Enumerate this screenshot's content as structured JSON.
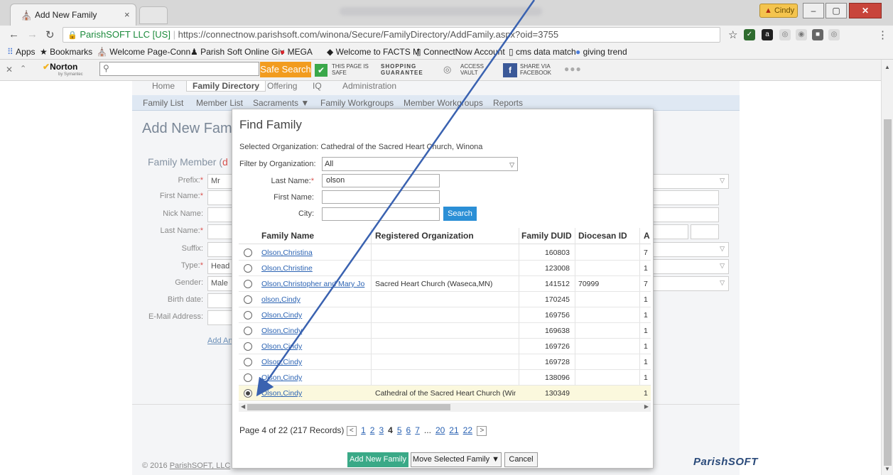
{
  "browser": {
    "tab_title": "Add New Family",
    "tab_close": "×",
    "profile_label": "Cindy",
    "url_secure_label": "ParishSOFT LLC [US]",
    "url": "https://connectnow.parishsoft.com/winona/Secure/FamilyDirectory/AddFamily.aspx?oid=3755",
    "bookmarks": [
      "Apps",
      "Bookmarks",
      "Welcome Page-Conn",
      "Parish Soft Online Giv",
      "MEGA",
      "Welcome to FACTS M",
      "ConnectNow Account",
      "cms data match",
      "giving trend"
    ]
  },
  "norton": {
    "logo": "Norton",
    "logo_sub": "by Symantec",
    "safe_search": "Safe Search",
    "page_is_safe_line1": "THIS PAGE IS",
    "page_is_safe_line2": "SAFE",
    "shopping_line1": "SHOPPING",
    "shopping_line2": "GUARANTEE",
    "access_line1": "ACCESS",
    "access_line2": "VAULT",
    "share_line1": "SHARE VIA",
    "share_line2": "FACEBOOK"
  },
  "app": {
    "main_tabs": [
      "Home",
      "Family Directory",
      "Offering",
      "IQ",
      "Administration"
    ],
    "subnav": [
      "Family List",
      "Member List",
      "Sacraments ▼",
      "Family Workgroups",
      "Member Workgroups",
      "Reports"
    ],
    "page_heading": "Add New Fami",
    "section_heading": "Family Member (",
    "section_heading_red": "d",
    "form_labels": [
      "Prefix:",
      "First Name:",
      "Nick Name:",
      "Last Name:",
      "Suffix:",
      "Type:",
      "Gender:",
      "Birth date:",
      "E-Mail Address:"
    ],
    "form_values": {
      "prefix": "Mr",
      "type": "Head",
      "gender": "Male"
    },
    "add_another": "Add Ano",
    "footer_copy": "© 2016 ",
    "footer_copy_link": "ParishSOFT, LLC",
    "footer_logo": "ParishSOFT"
  },
  "dialog": {
    "title": "Find Family",
    "selected_org_label": "Selected Organization:",
    "selected_org_value": "Cathedral of the Sacred Heart Church, Winona",
    "filter_label": "Filter by Organization:",
    "filter_value": "All",
    "last_name_label": "Last Name:",
    "last_name_value": "olson",
    "first_name_label": "First Name:",
    "first_name_value": "",
    "city_label": "City:",
    "city_value": "",
    "search_button": "Search",
    "columns": [
      "Family Name",
      "Registered Organization",
      "Family DUID",
      "Diocesan ID",
      "A"
    ],
    "rows": [
      {
        "name": "Olson,Christina",
        "org": "",
        "duid": "160803",
        "diocesan": "",
        "a": "7",
        "selected": false
      },
      {
        "name": "Olson,Christine",
        "org": "",
        "duid": "123008",
        "diocesan": "",
        "a": "1",
        "selected": false
      },
      {
        "name": "Olson,Christopher and Mary Jo",
        "org": "Sacred Heart Church (Waseca,MN)",
        "duid": "141512",
        "diocesan": "70999",
        "a": "7",
        "selected": false
      },
      {
        "name": "olson,Cindy",
        "org": "",
        "duid": "170245",
        "diocesan": "",
        "a": "1",
        "selected": false
      },
      {
        "name": "Olson,Cindy",
        "org": "",
        "duid": "169756",
        "diocesan": "",
        "a": "1",
        "selected": false
      },
      {
        "name": "Olson,Cindy",
        "org": "",
        "duid": "169638",
        "diocesan": "",
        "a": "1",
        "selected": false
      },
      {
        "name": "Olson,Cindy",
        "org": "",
        "duid": "169726",
        "diocesan": "",
        "a": "1",
        "selected": false
      },
      {
        "name": "Olson,Cindy",
        "org": "",
        "duid": "169728",
        "diocesan": "",
        "a": "1",
        "selected": false
      },
      {
        "name": "Olson,Cindy",
        "org": "",
        "duid": "138096",
        "diocesan": "",
        "a": "1",
        "selected": false
      },
      {
        "name": "Olson,Cindy",
        "org": "Cathedral of the Sacred Heart Church (Winor",
        "duid": "130349",
        "diocesan": "",
        "a": "1",
        "selected": true
      }
    ],
    "pager_text": "Page 4 of 22 (217 Records)",
    "pages": [
      "1",
      "2",
      "3",
      "4",
      "5",
      "6",
      "7",
      "...",
      "20",
      "21",
      "22"
    ],
    "current_page": "4",
    "btn_add_new": "Add New Family",
    "btn_move": "Move Selected Family ▼",
    "btn_cancel": "Cancel"
  }
}
